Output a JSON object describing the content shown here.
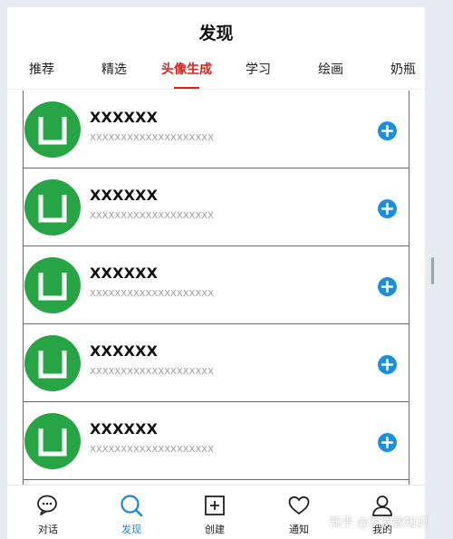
{
  "header": {
    "title": "发现"
  },
  "tabs": [
    {
      "label": "推荐",
      "active": false
    },
    {
      "label": "精选",
      "active": false
    },
    {
      "label": "头像生成",
      "active": true
    },
    {
      "label": "学习",
      "active": false
    },
    {
      "label": "绘画",
      "active": false
    },
    {
      "label": "奶瓶",
      "active": false
    }
  ],
  "list": {
    "items": [
      {
        "title": "XXXXXX",
        "subtitle": "XXXXXXXXXXXXXXXXXXXX",
        "avatar_icon": "u-letter-icon",
        "action_icon": "plus-circle-icon"
      },
      {
        "title": "XXXXXX",
        "subtitle": "XXXXXXXXXXXXXXXXXXXX",
        "avatar_icon": "u-letter-icon",
        "action_icon": "plus-circle-icon"
      },
      {
        "title": "XXXXXX",
        "subtitle": "XXXXXXXXXXXXXXXXXXXX",
        "avatar_icon": "u-letter-icon",
        "action_icon": "plus-circle-icon"
      },
      {
        "title": "XXXXXX",
        "subtitle": "XXXXXXXXXXXXXXXXXXXX",
        "avatar_icon": "u-letter-icon",
        "action_icon": "plus-circle-icon"
      },
      {
        "title": "XXXXXX",
        "subtitle": "XXXXXXXXXXXXXXXXXXXX",
        "avatar_icon": "u-letter-icon",
        "action_icon": "plus-circle-icon"
      }
    ]
  },
  "bottom_nav": {
    "items": [
      {
        "label": "对话",
        "icon": "chat-icon",
        "active": false
      },
      {
        "label": "发现",
        "icon": "search-icon",
        "active": true
      },
      {
        "label": "创建",
        "icon": "add-square-icon",
        "active": false
      },
      {
        "label": "通知",
        "icon": "heart-icon",
        "active": false
      },
      {
        "label": "我的",
        "icon": "user-icon",
        "active": false
      }
    ]
  },
  "watermark": {
    "text": "知乎 @罗罗教知识"
  },
  "colors": {
    "accent_red": "#d5231c",
    "accent_blue": "#1b84d7",
    "avatar_green": "#27a443",
    "add_button_blue": "#1a8fe0"
  }
}
